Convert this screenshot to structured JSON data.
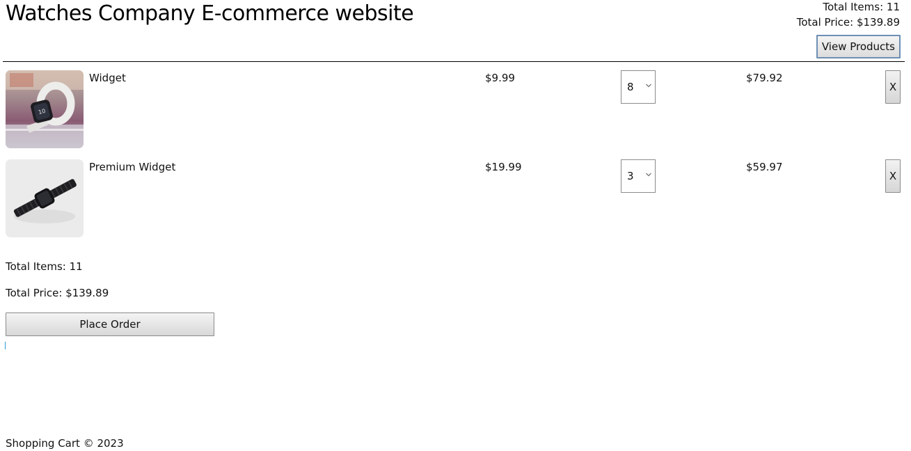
{
  "header": {
    "title": "Watches Company E-commerce website",
    "total_items_text": "Total Items: 11",
    "total_price_text": "Total Price: $139.89",
    "view_products_label": "View Products"
  },
  "cart": {
    "items": [
      {
        "name": "Widget",
        "price": "$9.99",
        "quantity": "8",
        "subtotal": "$79.92",
        "remove_label": "X",
        "image_icon": "smartwatch-photo"
      },
      {
        "name": "Premium Widget",
        "price": "$19.99",
        "quantity": "3",
        "subtotal": "$59.97",
        "remove_label": "X",
        "image_icon": "metal-watch-photo"
      }
    ]
  },
  "totals": {
    "total_items_text": "Total Items: 11",
    "total_price_text": "Total Price: $139.89",
    "place_order_label": "Place Order"
  },
  "footer": {
    "text": "Shopping Cart © 2023"
  },
  "colors": {
    "divider": "#000000",
    "caret": "#2a9bd6",
    "button_focus_border": "#6d8fb3"
  }
}
